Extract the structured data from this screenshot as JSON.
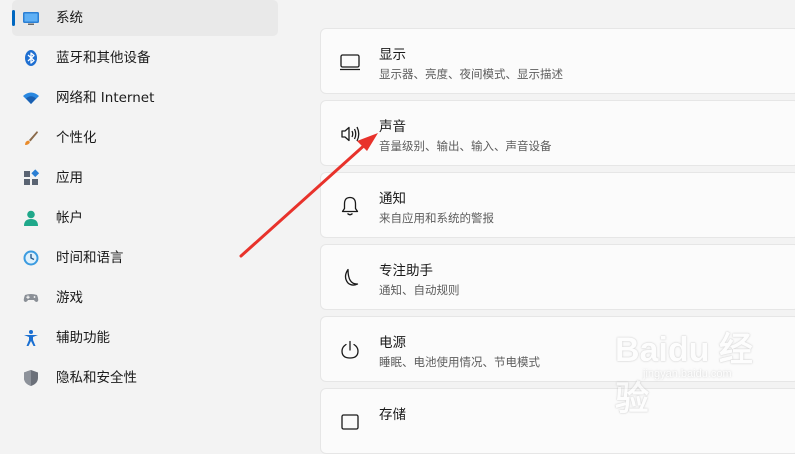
{
  "sidebar": {
    "items": [
      {
        "label": "系统",
        "icon": "display-icon",
        "selected": true
      },
      {
        "label": "蓝牙和其他设备",
        "icon": "bluetooth-icon"
      },
      {
        "label": "网络和 Internet",
        "icon": "wifi-icon"
      },
      {
        "label": "个性化",
        "icon": "brush-icon"
      },
      {
        "label": "应用",
        "icon": "apps-icon"
      },
      {
        "label": "帐户",
        "icon": "person-icon"
      },
      {
        "label": "时间和语言",
        "icon": "globe-clock-icon"
      },
      {
        "label": "游戏",
        "icon": "gamepad-icon"
      },
      {
        "label": "辅助功能",
        "icon": "accessibility-icon"
      },
      {
        "label": "隐私和安全性",
        "icon": "shield-icon"
      }
    ],
    "accent_color": "#0067c0"
  },
  "main": {
    "cards": [
      {
        "title": "显示",
        "desc": "显示器、亮度、夜间模式、显示描述",
        "icon": "monitor-icon"
      },
      {
        "title": "声音",
        "desc": "音量级别、输出、输入、声音设备",
        "icon": "speaker-icon"
      },
      {
        "title": "通知",
        "desc": "来自应用和系统的警报",
        "icon": "bell-icon"
      },
      {
        "title": "专注助手",
        "desc": "通知、自动规则",
        "icon": "moon-icon"
      },
      {
        "title": "电源",
        "desc": "睡眠、电池使用情况、节电模式",
        "icon": "power-icon"
      },
      {
        "title": "存储",
        "desc": "",
        "icon": "storage-icon"
      }
    ]
  },
  "annotation": {
    "arrow_color": "#e8322b"
  },
  "watermark": {
    "brand": "Baidu 经验",
    "url": "jingyan.baidu.com"
  }
}
